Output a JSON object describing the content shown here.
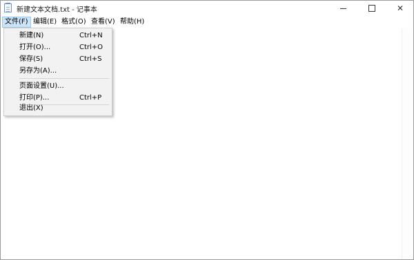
{
  "window": {
    "title": "新建文本文档.txt - 记事本",
    "controls": {
      "minimize": "—",
      "maximize": "□",
      "close": "✕"
    }
  },
  "menubar": {
    "items": [
      {
        "label": "文件(F)",
        "active": true
      },
      {
        "label": "编辑(E)"
      },
      {
        "label": "格式(O)"
      },
      {
        "label": "查看(V)"
      },
      {
        "label": "帮助(H)"
      }
    ]
  },
  "file_menu": {
    "items": [
      {
        "label": "新建(N)",
        "shortcut": "Ctrl+N"
      },
      {
        "label": "打开(O)...",
        "shortcut": "Ctrl+O"
      },
      {
        "label": "保存(S)",
        "shortcut": "Ctrl+S"
      },
      {
        "label": "另存为(A)...",
        "shortcut": ""
      },
      {
        "label": "页面设置(U)...",
        "shortcut": ""
      },
      {
        "label": "打印(P)...",
        "shortcut": "Ctrl+P"
      },
      {
        "label": "退出(X)",
        "shortcut": ""
      }
    ]
  },
  "icons": {
    "app": "notepad-icon",
    "minimize": "minimize-icon",
    "maximize": "maximize-icon",
    "close": "close-icon"
  },
  "colors": {
    "menu_highlight": "#cce4f7",
    "menu_highlight_border": "#99c9ef",
    "dropdown_bg": "#f2f2f2"
  }
}
